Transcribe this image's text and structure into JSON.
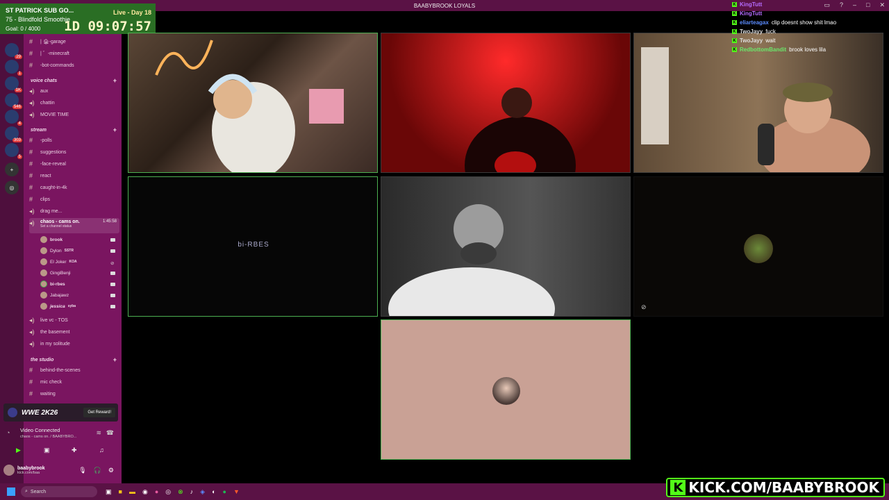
{
  "window": {
    "title": "BAABYBROOK LOYALS"
  },
  "stream_overlay": {
    "title": "ST PATRICK SUB GO...",
    "goal_line": "75 - Blindfold Smoothie",
    "goal": "Goal: 0 / 4000",
    "live_day": "Live - Day 18",
    "timer": "1D 09:07:57"
  },
  "servers": [
    {
      "badge": "29"
    },
    {
      "badge": "1"
    },
    {
      "badge": "1K"
    },
    {
      "badge": "546"
    },
    {
      "badge": "4"
    },
    {
      "badge": "303"
    },
    {
      "badge": "5"
    }
  ],
  "channels": [
    {
      "type": "text",
      "label": "| 🏚-garage"
    },
    {
      "type": "text",
      "label": "| ゛-minecraft"
    },
    {
      "type": "text",
      "label": "-bot-commands"
    },
    {
      "type": "category",
      "label": "voice chats"
    },
    {
      "type": "voice",
      "label": "aux"
    },
    {
      "type": "voice",
      "label": "chattin"
    },
    {
      "type": "voice",
      "label": "MOVIE TIME"
    },
    {
      "type": "category",
      "label": "stream"
    },
    {
      "type": "text",
      "label": "-polls"
    },
    {
      "type": "text",
      "label": "suggestions"
    },
    {
      "type": "text",
      "label": "-face-reveal"
    },
    {
      "type": "text",
      "label": "react"
    },
    {
      "type": "text",
      "label": "caught-in-4k"
    },
    {
      "type": "text",
      "label": "clips"
    },
    {
      "type": "voice",
      "label": "drag me..."
    },
    {
      "type": "voice",
      "label": "chaos - cams on.",
      "time": "1:45:58",
      "status": "Set a channel status"
    }
  ],
  "members": [
    {
      "name": "brook"
    },
    {
      "name": "Dylon",
      "tag": "SSTR"
    },
    {
      "name": "El Joker",
      "tag": "KOA"
    },
    {
      "name": "GingiBenji"
    },
    {
      "name": "bi-rbes"
    },
    {
      "name": "Jabajawz"
    },
    {
      "name": "jessica",
      "tag": "syba"
    }
  ],
  "channels_lower": [
    {
      "type": "voice",
      "label": "live vc - TOS"
    },
    {
      "type": "voice",
      "label": "the basement"
    },
    {
      "type": "voice",
      "label": "in my solitude"
    },
    {
      "type": "category",
      "label": "the studio"
    },
    {
      "type": "text",
      "label": "behind-the-scenes"
    },
    {
      "type": "text",
      "label": "mic check"
    },
    {
      "type": "text",
      "label": "waiting"
    }
  ],
  "promo": {
    "game": "WWE 2K26",
    "button": "Get Reward!"
  },
  "voice_status": {
    "title": "Video Connected",
    "subtitle": "chaos - cams on. / BAABYBRO..."
  },
  "user": {
    "name": "baabybrook",
    "sub": "kick.com/baa"
  },
  "tiles": [
    {
      "name": "brook-tile",
      "speaking": true
    },
    {
      "name": "participant-2"
    },
    {
      "name": "participant-3"
    },
    {
      "name": "bi-rbes-tile",
      "label": "bi-RBES",
      "speaking": true
    },
    {
      "name": "participant-5"
    },
    {
      "name": "participant-6"
    },
    {
      "name": "participant-7",
      "speaking": true
    }
  ],
  "chat": [
    {
      "user": "KingTutt",
      "text": "",
      "color": "#b56cff"
    },
    {
      "user": "KingTutt",
      "text": "",
      "color": "#b56cff"
    },
    {
      "user": "eliarteagax",
      "text": "clip doesnt show shit lmao",
      "color": "#5b8cff"
    },
    {
      "user": "TwoJayy",
      "text": "fuck",
      "color": "#dddddd"
    },
    {
      "user": "TwoJayy",
      "text": "wait",
      "color": "#dddddd"
    },
    {
      "user": "RedbottomBandit",
      "text": "brook loves lila",
      "color": "#6be86b"
    }
  ],
  "search": {
    "placeholder": "Search"
  },
  "kick_banner": "KICK.COM/BAABYBROOK",
  "colors": {
    "accent": "#7a1560",
    "kick_green": "#53fc18",
    "speaking": "#4caf50"
  }
}
